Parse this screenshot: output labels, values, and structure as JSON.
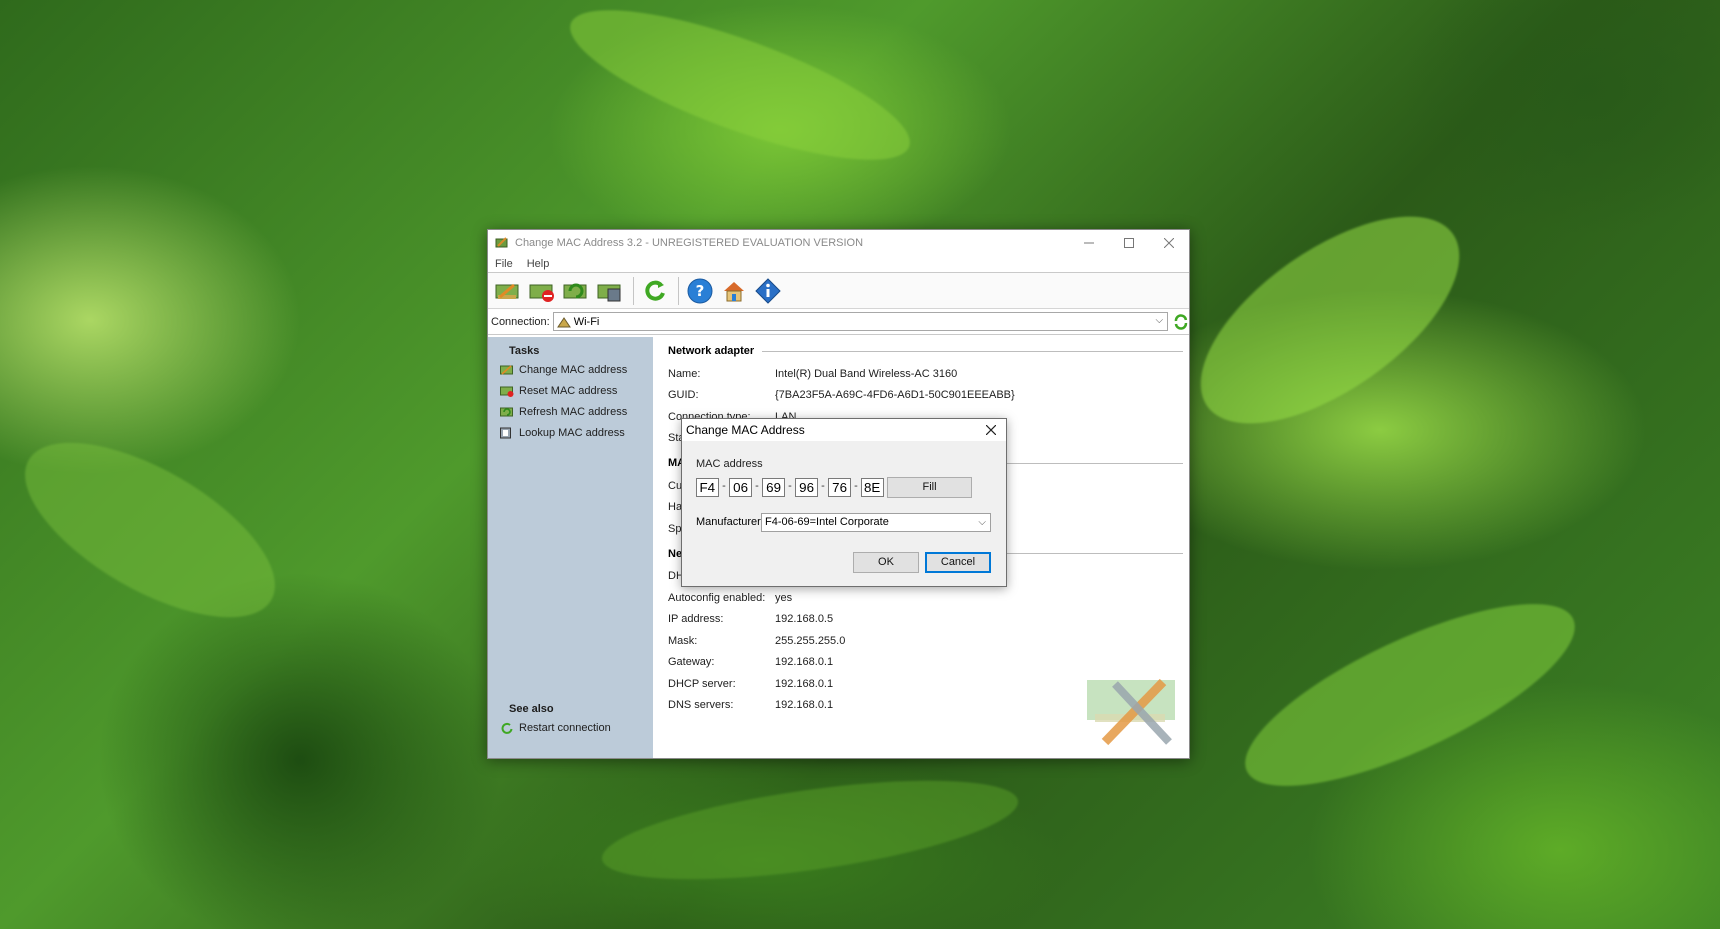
{
  "window": {
    "title": "Change MAC Address 3.2 - UNREGISTERED EVALUATION VERSION",
    "menu": [
      "File",
      "Help"
    ]
  },
  "toolbar": {
    "icons": [
      "change-mac-icon",
      "reset-mac-icon",
      "refresh-mac-icon",
      "lookup-mac-icon",
      "restart-connection-icon",
      "help-icon",
      "home-icon",
      "about-icon"
    ]
  },
  "connection": {
    "label": "Connection:",
    "value": "Wi-Fi"
  },
  "sidebar": {
    "tasks_header": "Tasks",
    "tasks": [
      {
        "label": "Change MAC address"
      },
      {
        "label": "Reset MAC address"
      },
      {
        "label": "Refresh MAC address"
      },
      {
        "label": "Lookup MAC address"
      }
    ],
    "see_also_header": "See also",
    "see_also": [
      {
        "label": "Restart connection"
      }
    ]
  },
  "adapter": {
    "section": "Network adapter",
    "rows": [
      {
        "key": "Name:",
        "value": "Intel(R) Dual Band Wireless-AC 3160"
      },
      {
        "key": "GUID:",
        "value": "{7BA23F5A-A69C-4FD6-A6D1-50C901EEEABB}"
      },
      {
        "key": "Connection type:",
        "value": "LAN"
      },
      {
        "key": "Sta",
        "value": ""
      }
    ]
  },
  "mac_section": {
    "section": "MA",
    "rows": [
      {
        "key": "Cu",
        "value": ""
      },
      {
        "key": "Ha",
        "value": ""
      },
      {
        "key": "Sp",
        "value": ""
      }
    ]
  },
  "network_section": {
    "section": "Ne",
    "rows": [
      {
        "key": "DH",
        "value": ""
      },
      {
        "key": "Autoconfig enabled:",
        "value": "yes"
      },
      {
        "key": "IP address:",
        "value": "192.168.0.5"
      },
      {
        "key": "Mask:",
        "value": "255.255.255.0"
      },
      {
        "key": "Gateway:",
        "value": "192.168.0.1"
      },
      {
        "key": "DHCP server:",
        "value": "192.168.0.1"
      },
      {
        "key": "DNS servers:",
        "value": "192.168.0.1"
      }
    ]
  },
  "dialog": {
    "title": "Change MAC Address",
    "mac_label": "MAC address",
    "mac_octets": [
      "F4",
      "06",
      "69",
      "96",
      "76",
      "8E"
    ],
    "separator": "-",
    "fill_label": "Fill",
    "manufacturer_label": "Manufacturer",
    "manufacturer_value": "F4-06-69=Intel Corporate",
    "ok_label": "OK",
    "cancel_label": "Cancel"
  },
  "colors": {
    "sidebar_bg": "#bccbd9",
    "accent_blue": "#0078d7",
    "dialog_bg": "#f0f0f0"
  }
}
